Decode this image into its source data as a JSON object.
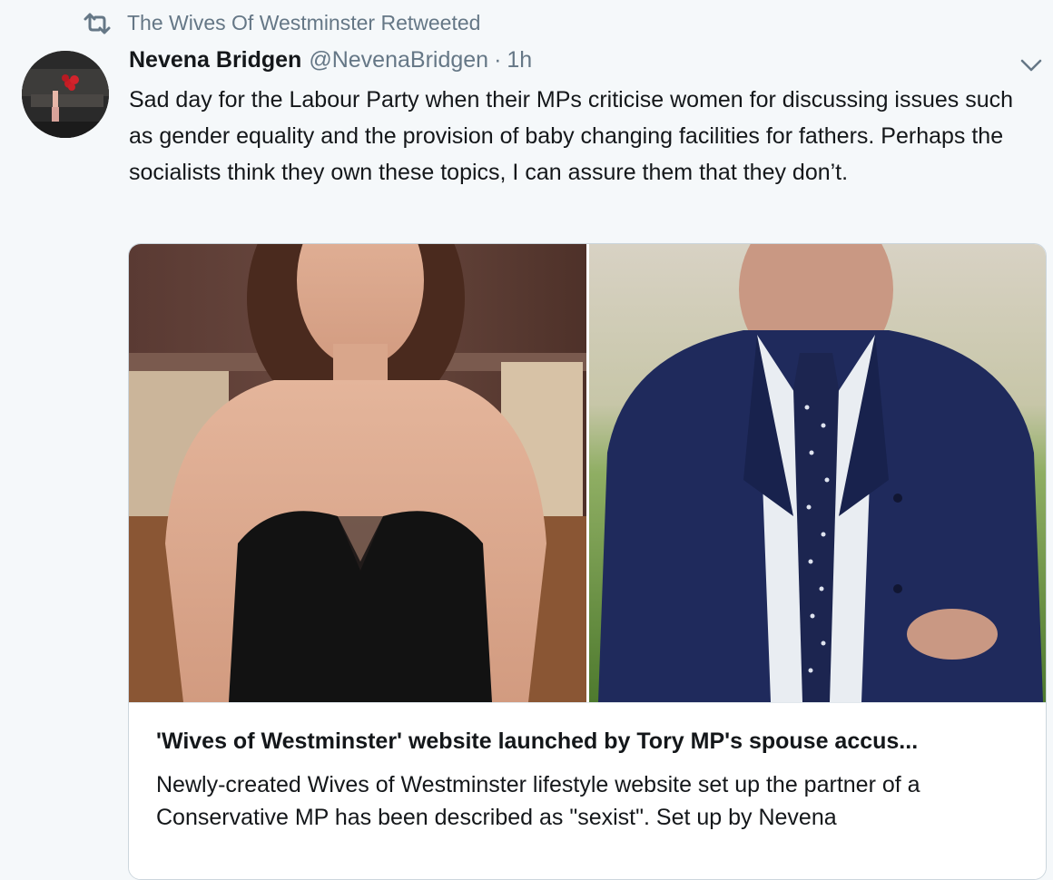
{
  "retweet": {
    "label": "The Wives Of Westminster Retweeted",
    "icon": "retweet-icon"
  },
  "tweet": {
    "author_name": "Nevena Bridgen",
    "author_handle": "@NevenaBridgen",
    "separator": "·",
    "time": "1h",
    "text": "Sad day for the Labour Party when their MPs criticise women for discussing issues such as gender equality and the provision of baby changing facilities for fathers. Perhaps the socialists think they own these topics, I can assure them that they don’t."
  },
  "card": {
    "title": "'Wives of Westminster' website launched by Tory MP's spouse accus...",
    "description": "Newly-created Wives of Westminster lifestyle website set up the partner of a Conservative MP has been described as \"sexist\". Set up by Nevena"
  },
  "colors": {
    "background": "#f5f8fa",
    "secondary_text": "#657786",
    "primary_text": "#14171a",
    "card_border": "#ccd6dd"
  }
}
